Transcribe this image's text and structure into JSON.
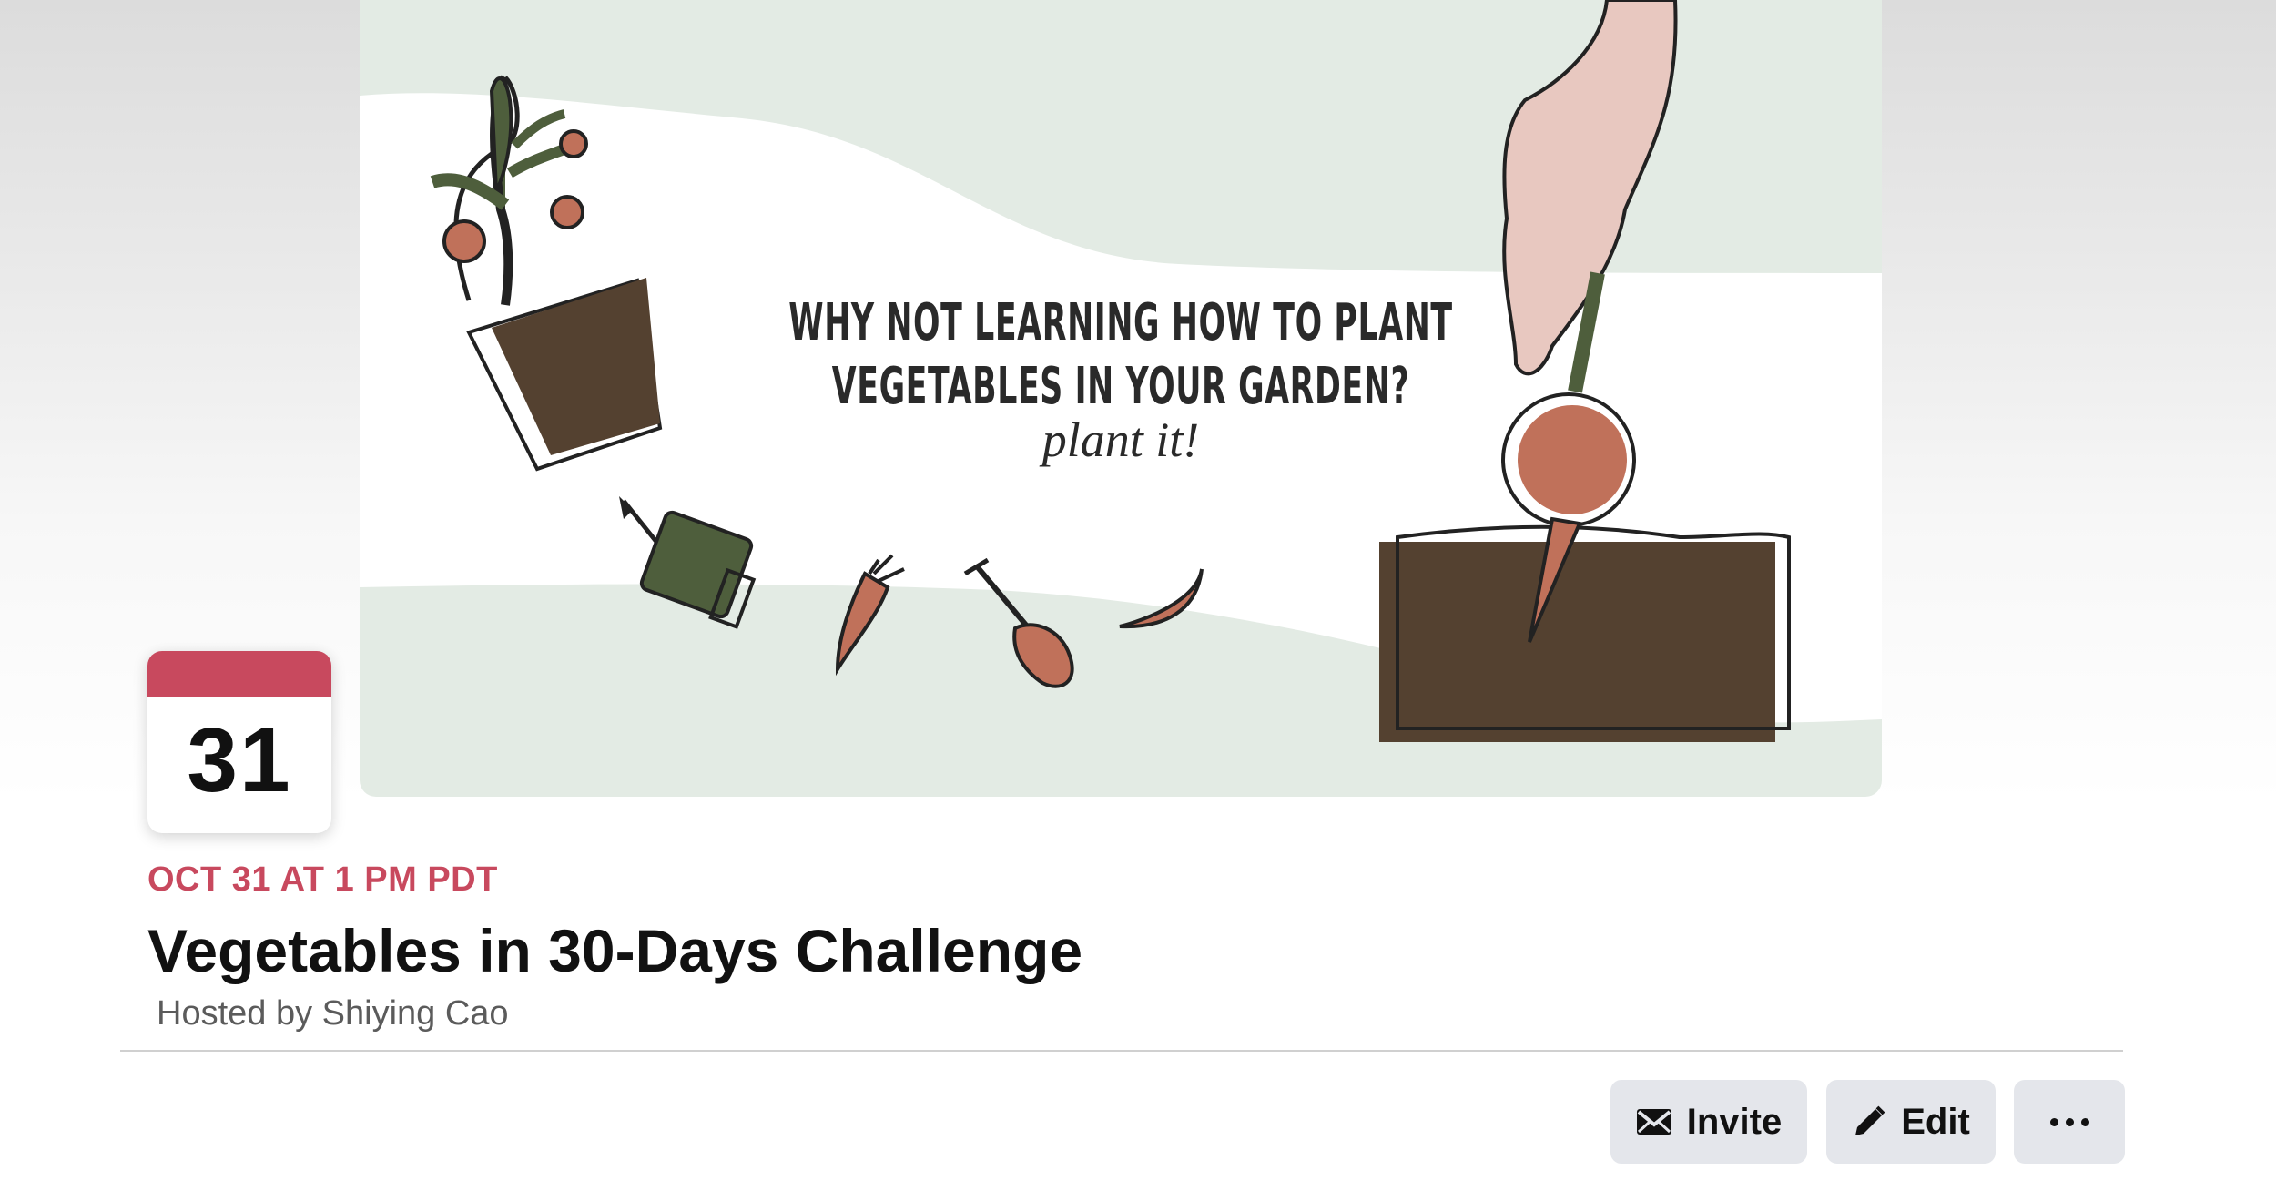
{
  "cover": {
    "headline_line1": "WHY NOT LEARNING HOW TO PLANT",
    "headline_line2": "VEGETABLES IN YOUR GARDEN?",
    "tagline": "plant it!"
  },
  "date_card": {
    "day": "31",
    "accent_color": "#c8495e"
  },
  "event": {
    "when": "OCT 31 AT 1 PM PDT",
    "title": "Vegetables in 30-Days Challenge",
    "host": "Hosted by Shiying Cao"
  },
  "actions": {
    "invite_label": "Invite",
    "invite_icon": "envelope-icon",
    "edit_label": "Edit",
    "edit_icon": "pencil-icon",
    "more_icon": "more-options-icon"
  }
}
